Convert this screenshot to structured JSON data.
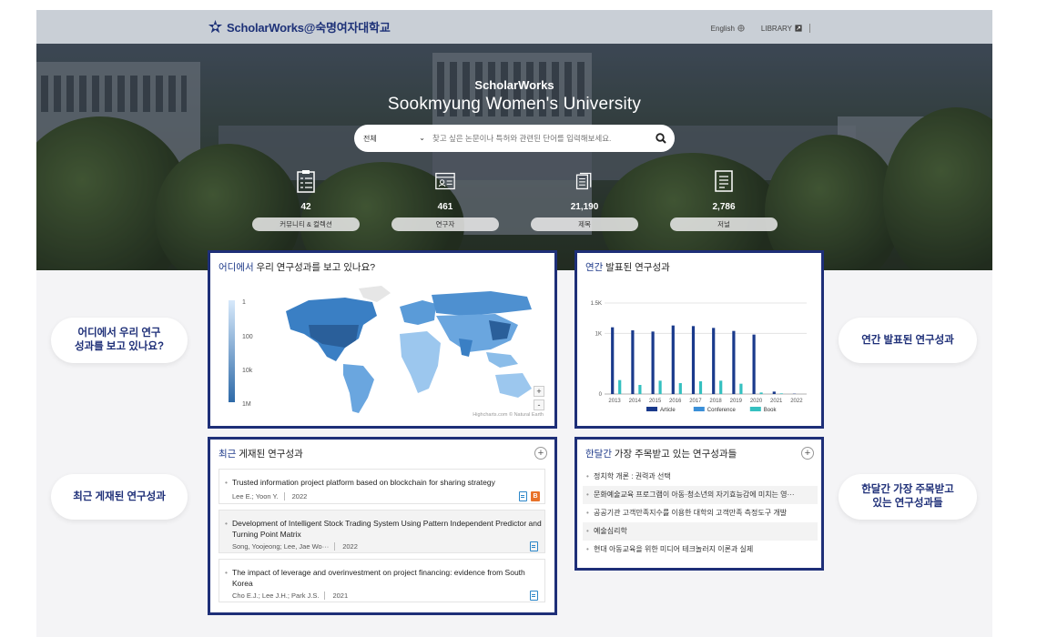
{
  "header": {
    "logo_text": "ScholarWorks@숙명여자대학교",
    "links": [
      "English",
      "LIBRARY"
    ]
  },
  "hero": {
    "subtitle": "ScholarWorks",
    "title": "Sookmyung Women's University",
    "search": {
      "scope": "전체",
      "placeholder": "찾고 싶은 논문이나 특허와 관련된 단어를 입력해보세요."
    },
    "stats": [
      {
        "icon": "clipboard-icon",
        "value": "42",
        "label": "커뮤니티 & 컬렉션"
      },
      {
        "icon": "researcher-card-icon",
        "value": "461",
        "label": "연구자"
      },
      {
        "icon": "books-icon",
        "value": "21,190",
        "label": "제목"
      },
      {
        "icon": "journal-icon",
        "value": "2,786",
        "label": "저널"
      }
    ]
  },
  "bubbles": {
    "map": "어디에서 우리 연구\n성과를 보고 있나요?",
    "annual": "연간 발표된 연구성과",
    "recent": "최근 게재된 연구성과",
    "popular": "한달간 가장 주목받고\n있는 연구성과들"
  },
  "map_card": {
    "title_hl": "어디에서",
    "title_rest": " 우리 연구성과를 보고 있나요?",
    "legend": [
      "1",
      "100",
      "10k",
      "1M"
    ],
    "zoom_in": "+",
    "zoom_out": "-",
    "credit": "Highcharts.com © Natural Earth"
  },
  "annual_card": {
    "title_hl": "연간",
    "title_rest": " 발표된 연구성과"
  },
  "chart_data": {
    "type": "bar",
    "title": "연간 발표된 연구성과",
    "categories": [
      "2013",
      "2014",
      "2015",
      "2016",
      "2017",
      "2018",
      "2019",
      "2020",
      "2021",
      "2022"
    ],
    "series": [
      {
        "name": "Article",
        "color": "#1a3a8c",
        "values": [
          1100,
          1050,
          1030,
          1130,
          1120,
          1090,
          1040,
          980,
          40,
          5
        ]
      },
      {
        "name": "Conference",
        "color": "#3a8fd8",
        "values": [
          0,
          0,
          0,
          0,
          0,
          0,
          0,
          0,
          0,
          0
        ]
      },
      {
        "name": "Book",
        "color": "#35c0c0",
        "values": [
          230,
          150,
          220,
          180,
          210,
          220,
          170,
          25,
          10,
          0
        ]
      }
    ],
    "y_ticks": [
      "0",
      "1K",
      "1.5K"
    ],
    "ylim": [
      0,
      1500
    ],
    "grid": true,
    "legend_position": "bottom"
  },
  "recent_card": {
    "title_hl": "최근",
    "title_rest": " 게재된 연구성과",
    "items": [
      {
        "title": "Trusted information project platform based on blockchain for sharing strategy",
        "authors": "Lee E.; Yoon Y.",
        "year": "2022",
        "badges": [
          "doc",
          "b"
        ]
      },
      {
        "title": "Development of Intelligent Stock Trading System Using Pattern Independent Predictor and Turning Point Matrix",
        "authors": "Song, Yoojeong; Lee, Jae Wo···",
        "year": "2022",
        "badges": [
          "doc"
        ]
      },
      {
        "title": "The impact of leverage and overinvestment on project financing: evidence from South Korea",
        "authors": "Cho E.J.; Lee J.H.; Park J.S.",
        "year": "2021",
        "badges": [
          "doc"
        ]
      }
    ]
  },
  "popular_card": {
    "title_hl": "한달간",
    "title_rest": " 가장 주목받고 있는 연구성과들",
    "items": [
      "정치학 개론 : 권력과 선택",
      "문화예술교육 프로그램이 아동·청소년의 자기효능감에 미치는 영···",
      "공공기관 고객만족지수를 이용한 대학의 고객만족 측정도구 개발",
      "예술심리학",
      "현대 아동교육을 위한 미디어 테크놀러지 이론과 실제"
    ]
  }
}
